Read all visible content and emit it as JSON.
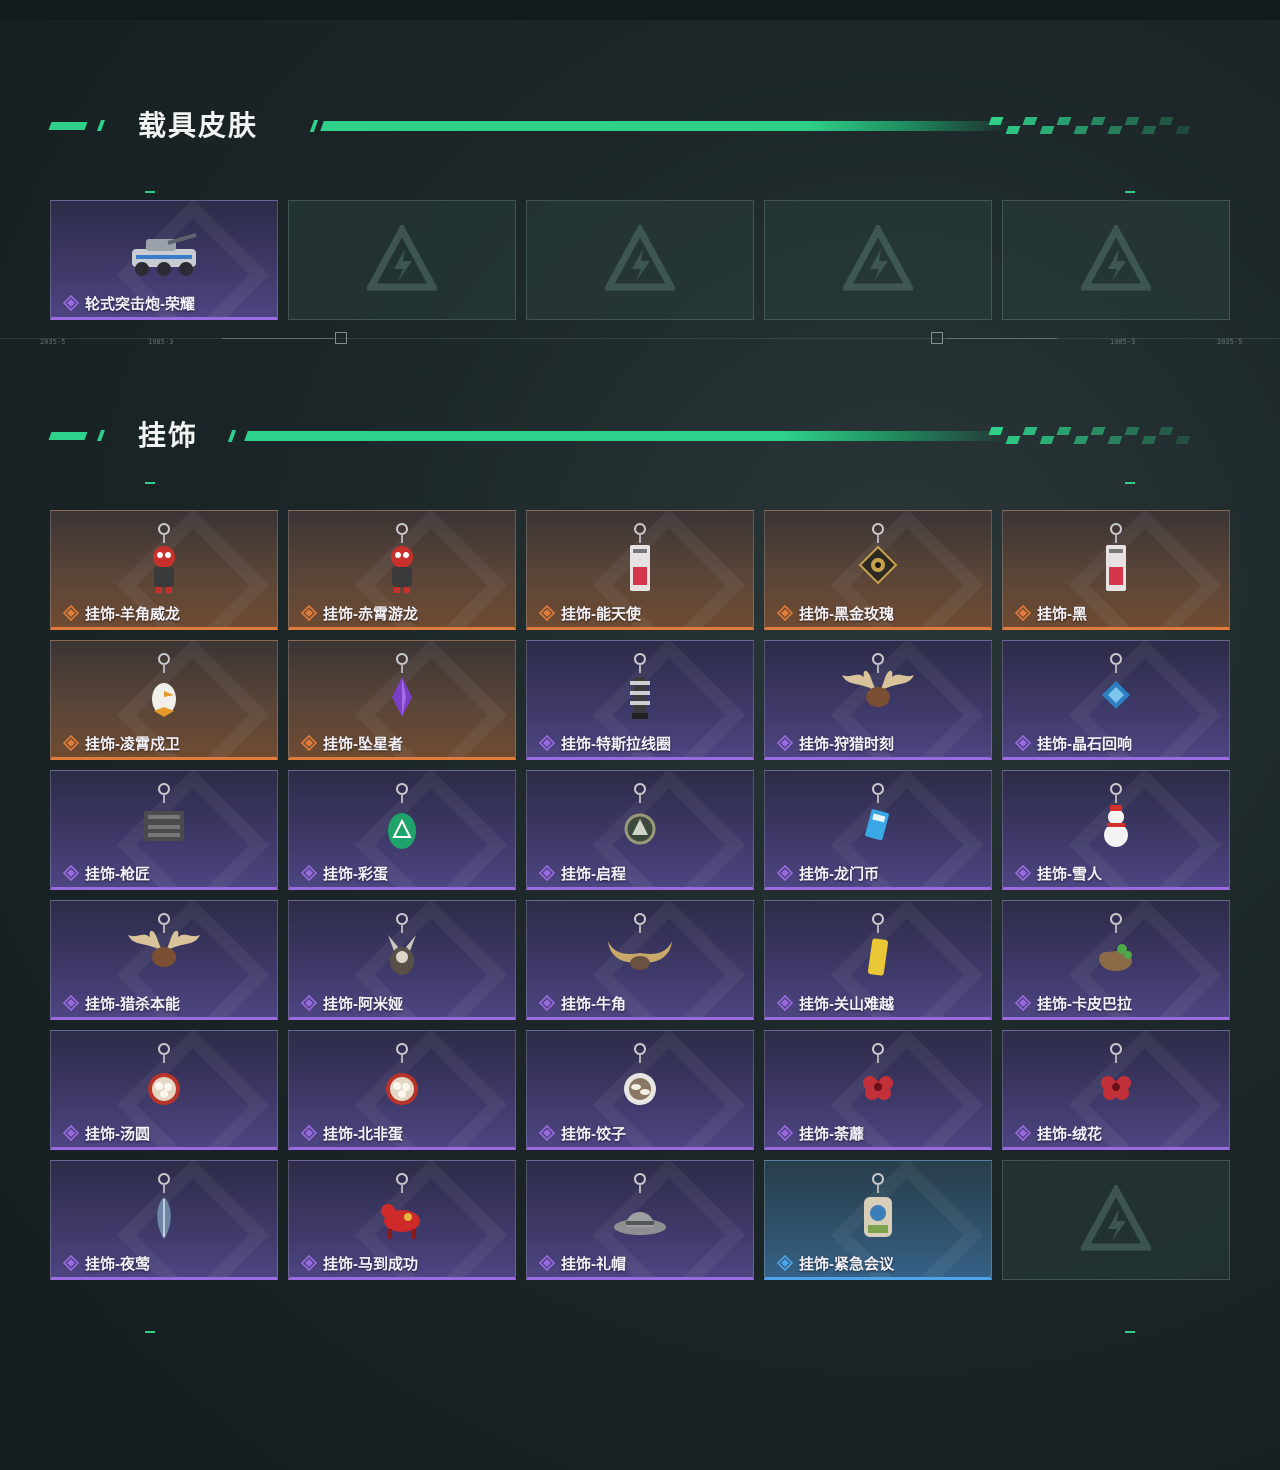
{
  "sections": {
    "vehicle": {
      "title": "载具皮肤",
      "items": [
        {
          "label": "轮式突击炮-荣耀",
          "rarity": "purple",
          "icon": "armored-vehicle-icon"
        },
        {
          "label": "",
          "rarity": "empty",
          "icon": "game-logo-icon"
        },
        {
          "label": "",
          "rarity": "empty",
          "icon": "game-logo-icon"
        },
        {
          "label": "",
          "rarity": "empty",
          "icon": "game-logo-icon"
        },
        {
          "label": "",
          "rarity": "empty",
          "icon": "game-logo-icon"
        }
      ]
    },
    "charms": {
      "title": "挂饰",
      "items": [
        {
          "label": "挂饰-羊角威龙",
          "rarity": "orange",
          "icon": "dragon-figure-charm-icon"
        },
        {
          "label": "挂饰-赤霄游龙",
          "rarity": "orange",
          "icon": "dragon-figure-charm-icon"
        },
        {
          "label": "挂饰-能天使",
          "rarity": "orange",
          "icon": "tag-charm-icon"
        },
        {
          "label": "挂饰-黑金玫瑰",
          "rarity": "orange",
          "icon": "rose-badge-charm-icon"
        },
        {
          "label": "挂饰-黑",
          "rarity": "orange",
          "icon": "tag-charm-icon"
        },
        {
          "label": "挂饰-凌霄戍卫",
          "rarity": "orange",
          "icon": "bird-charm-icon"
        },
        {
          "label": "挂饰-坠星者",
          "rarity": "orange",
          "icon": "crystal-charm-icon"
        },
        {
          "label": "挂饰-特斯拉线圈",
          "rarity": "purple",
          "icon": "coil-charm-icon"
        },
        {
          "label": "挂饰-狩猎时刻",
          "rarity": "purple",
          "icon": "antler-charm-icon"
        },
        {
          "label": "挂饰-晶石回响",
          "rarity": "purple",
          "icon": "gem-charm-icon"
        },
        {
          "label": "挂饰-枪匠",
          "rarity": "purple",
          "icon": "crate-charm-icon"
        },
        {
          "label": "挂饰-彩蛋",
          "rarity": "purple",
          "icon": "egg-charm-icon"
        },
        {
          "label": "挂饰-启程",
          "rarity": "purple",
          "icon": "medal-charm-icon"
        },
        {
          "label": "挂饰-龙门币",
          "rarity": "purple",
          "icon": "card-charm-icon"
        },
        {
          "label": "挂饰-雪人",
          "rarity": "purple",
          "icon": "snowman-charm-icon"
        },
        {
          "label": "挂饰-猎杀本能",
          "rarity": "purple",
          "icon": "antler-charm-icon"
        },
        {
          "label": "挂饰-阿米娅",
          "rarity": "purple",
          "icon": "bunny-charm-icon"
        },
        {
          "label": "挂饰-牛角",
          "rarity": "purple",
          "icon": "horn-charm-icon"
        },
        {
          "label": "挂饰-关山难越",
          "rarity": "purple",
          "icon": "bar-charm-icon"
        },
        {
          "label": "挂饰-卡皮巴拉",
          "rarity": "purple",
          "icon": "capybara-charm-icon"
        },
        {
          "label": "挂饰-汤圆",
          "rarity": "purple",
          "icon": "bowl-charm-icon"
        },
        {
          "label": "挂饰-北非蛋",
          "rarity": "purple",
          "icon": "bowl-charm-icon"
        },
        {
          "label": "挂饰-饺子",
          "rarity": "purple",
          "icon": "plate-charm-icon"
        },
        {
          "label": "挂饰-荼蘼",
          "rarity": "purple",
          "icon": "flower-charm-icon"
        },
        {
          "label": "挂饰-绒花",
          "rarity": "purple",
          "icon": "flower-charm-icon"
        },
        {
          "label": "挂饰-夜莺",
          "rarity": "purple",
          "icon": "feather-charm-icon"
        },
        {
          "label": "挂饰-马到成功",
          "rarity": "purple",
          "icon": "horse-charm-icon"
        },
        {
          "label": "挂饰-礼帽",
          "rarity": "purple",
          "icon": "hat-charm-icon"
        },
        {
          "label": "挂饰-紧急会议",
          "rarity": "blue",
          "icon": "badge-charm-icon"
        },
        {
          "label": "",
          "rarity": "empty",
          "icon": "game-logo-icon"
        }
      ]
    }
  },
  "hud": {
    "left_text_1": "2035-5",
    "left_text_2": "1985-3",
    "right_text_1": "1985-3",
    "right_text_2": "2035-5"
  },
  "colors": {
    "accent": "#2fd18a",
    "purple_rarity": "#9a6be0",
    "orange_rarity": "#e07b3a",
    "blue_rarity": "#4fa3e8"
  }
}
